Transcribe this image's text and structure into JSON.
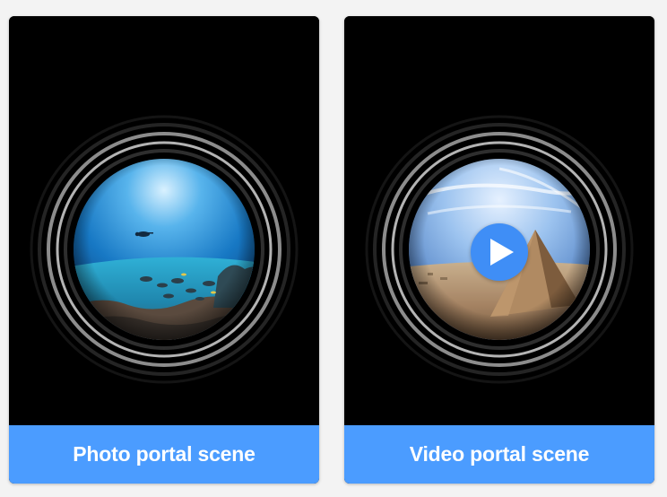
{
  "cards": [
    {
      "id": "photo",
      "title": "Photo portal scene",
      "scene": "underwater-reef",
      "has_play_button": false
    },
    {
      "id": "video",
      "title": "Video portal scene",
      "scene": "desert-pyramid",
      "has_play_button": true,
      "play_icon": "play-icon"
    }
  ],
  "colors": {
    "page_background": "#f3f3f3",
    "card_background": "#000000",
    "footer_background": "#4b9cff",
    "footer_text": "#ffffff",
    "play_button": "#3f8ef6",
    "ring": "#bdbdbd"
  }
}
